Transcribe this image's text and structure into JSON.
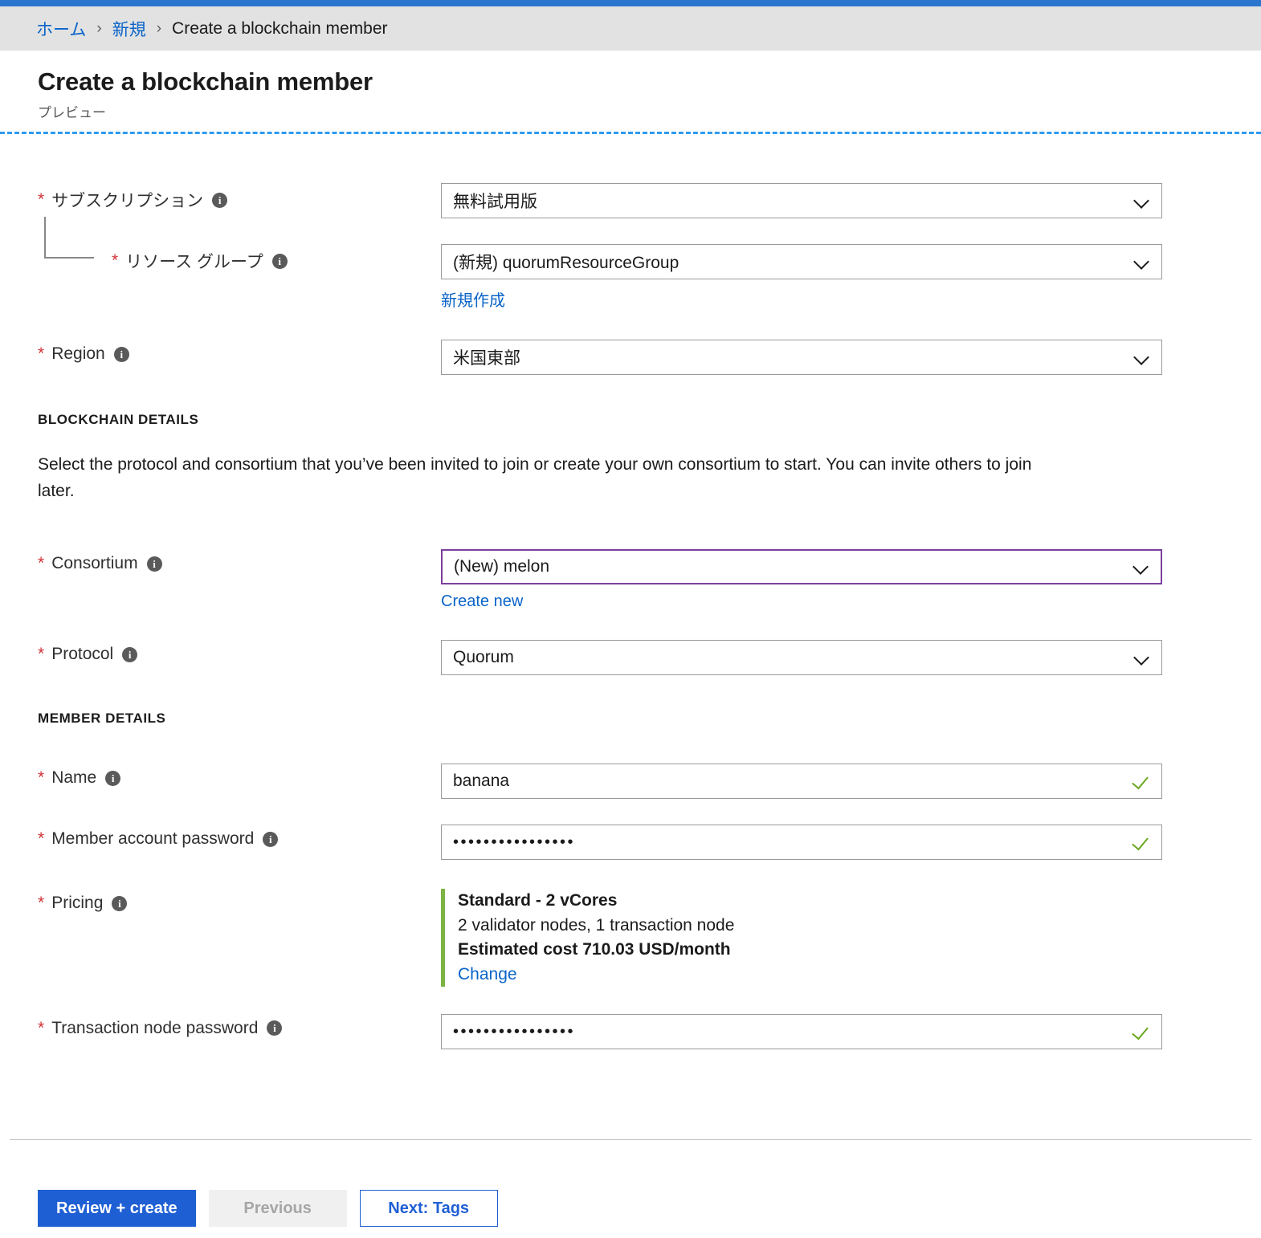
{
  "breadcrumb": {
    "home": "ホーム",
    "new": "新規",
    "current": "Create a blockchain member",
    "separator": "›"
  },
  "header": {
    "title": "Create a blockchain member",
    "subtitle": "プレビュー"
  },
  "project_section": {
    "subscription": {
      "label": "サブスクリプション",
      "value": "無料試用版"
    },
    "resource_group": {
      "label": "リソース グループ",
      "value": "(新規) quorumResourceGroup",
      "create_new_link": "新規作成"
    },
    "region": {
      "label": "Region",
      "value": "米国東部"
    }
  },
  "blockchain_details": {
    "heading": "BLOCKCHAIN DETAILS",
    "description": "Select the protocol and consortium that you’ve been invited to join or create your own consortium to start. You can invite others to join later.",
    "consortium": {
      "label": "Consortium",
      "value": "(New) melon",
      "create_new_link": "Create new"
    },
    "protocol": {
      "label": "Protocol",
      "value": "Quorum"
    }
  },
  "member_details": {
    "heading": "MEMBER DETAILS",
    "name": {
      "label": "Name",
      "value": "banana"
    },
    "member_account_password": {
      "label": "Member account password",
      "value": "••••••••••••••••"
    },
    "pricing": {
      "label": "Pricing",
      "tier": "Standard - 2 vCores",
      "nodes": "2 validator nodes, 1 transaction node",
      "estimated_cost": "Estimated cost 710.03 USD/month",
      "change_link": "Change"
    },
    "transaction_node_password": {
      "label": "Transaction node password",
      "value": "••••••••••••••••"
    }
  },
  "footer": {
    "review_create": "Review + create",
    "previous": "Previous",
    "next": "Next: Tags"
  },
  "icons": {
    "info": "i"
  },
  "colors": {
    "accent_blue": "#2a76cf",
    "link_blue": "#0a64c8",
    "primary_button": "#1f5fd4",
    "required_red": "#d13438",
    "valid_green": "#6aa820",
    "pricing_bar_green": "#7cb342",
    "focus_purple": "#7b3f9d",
    "focus_dash_blue": "#2f9bf0"
  }
}
